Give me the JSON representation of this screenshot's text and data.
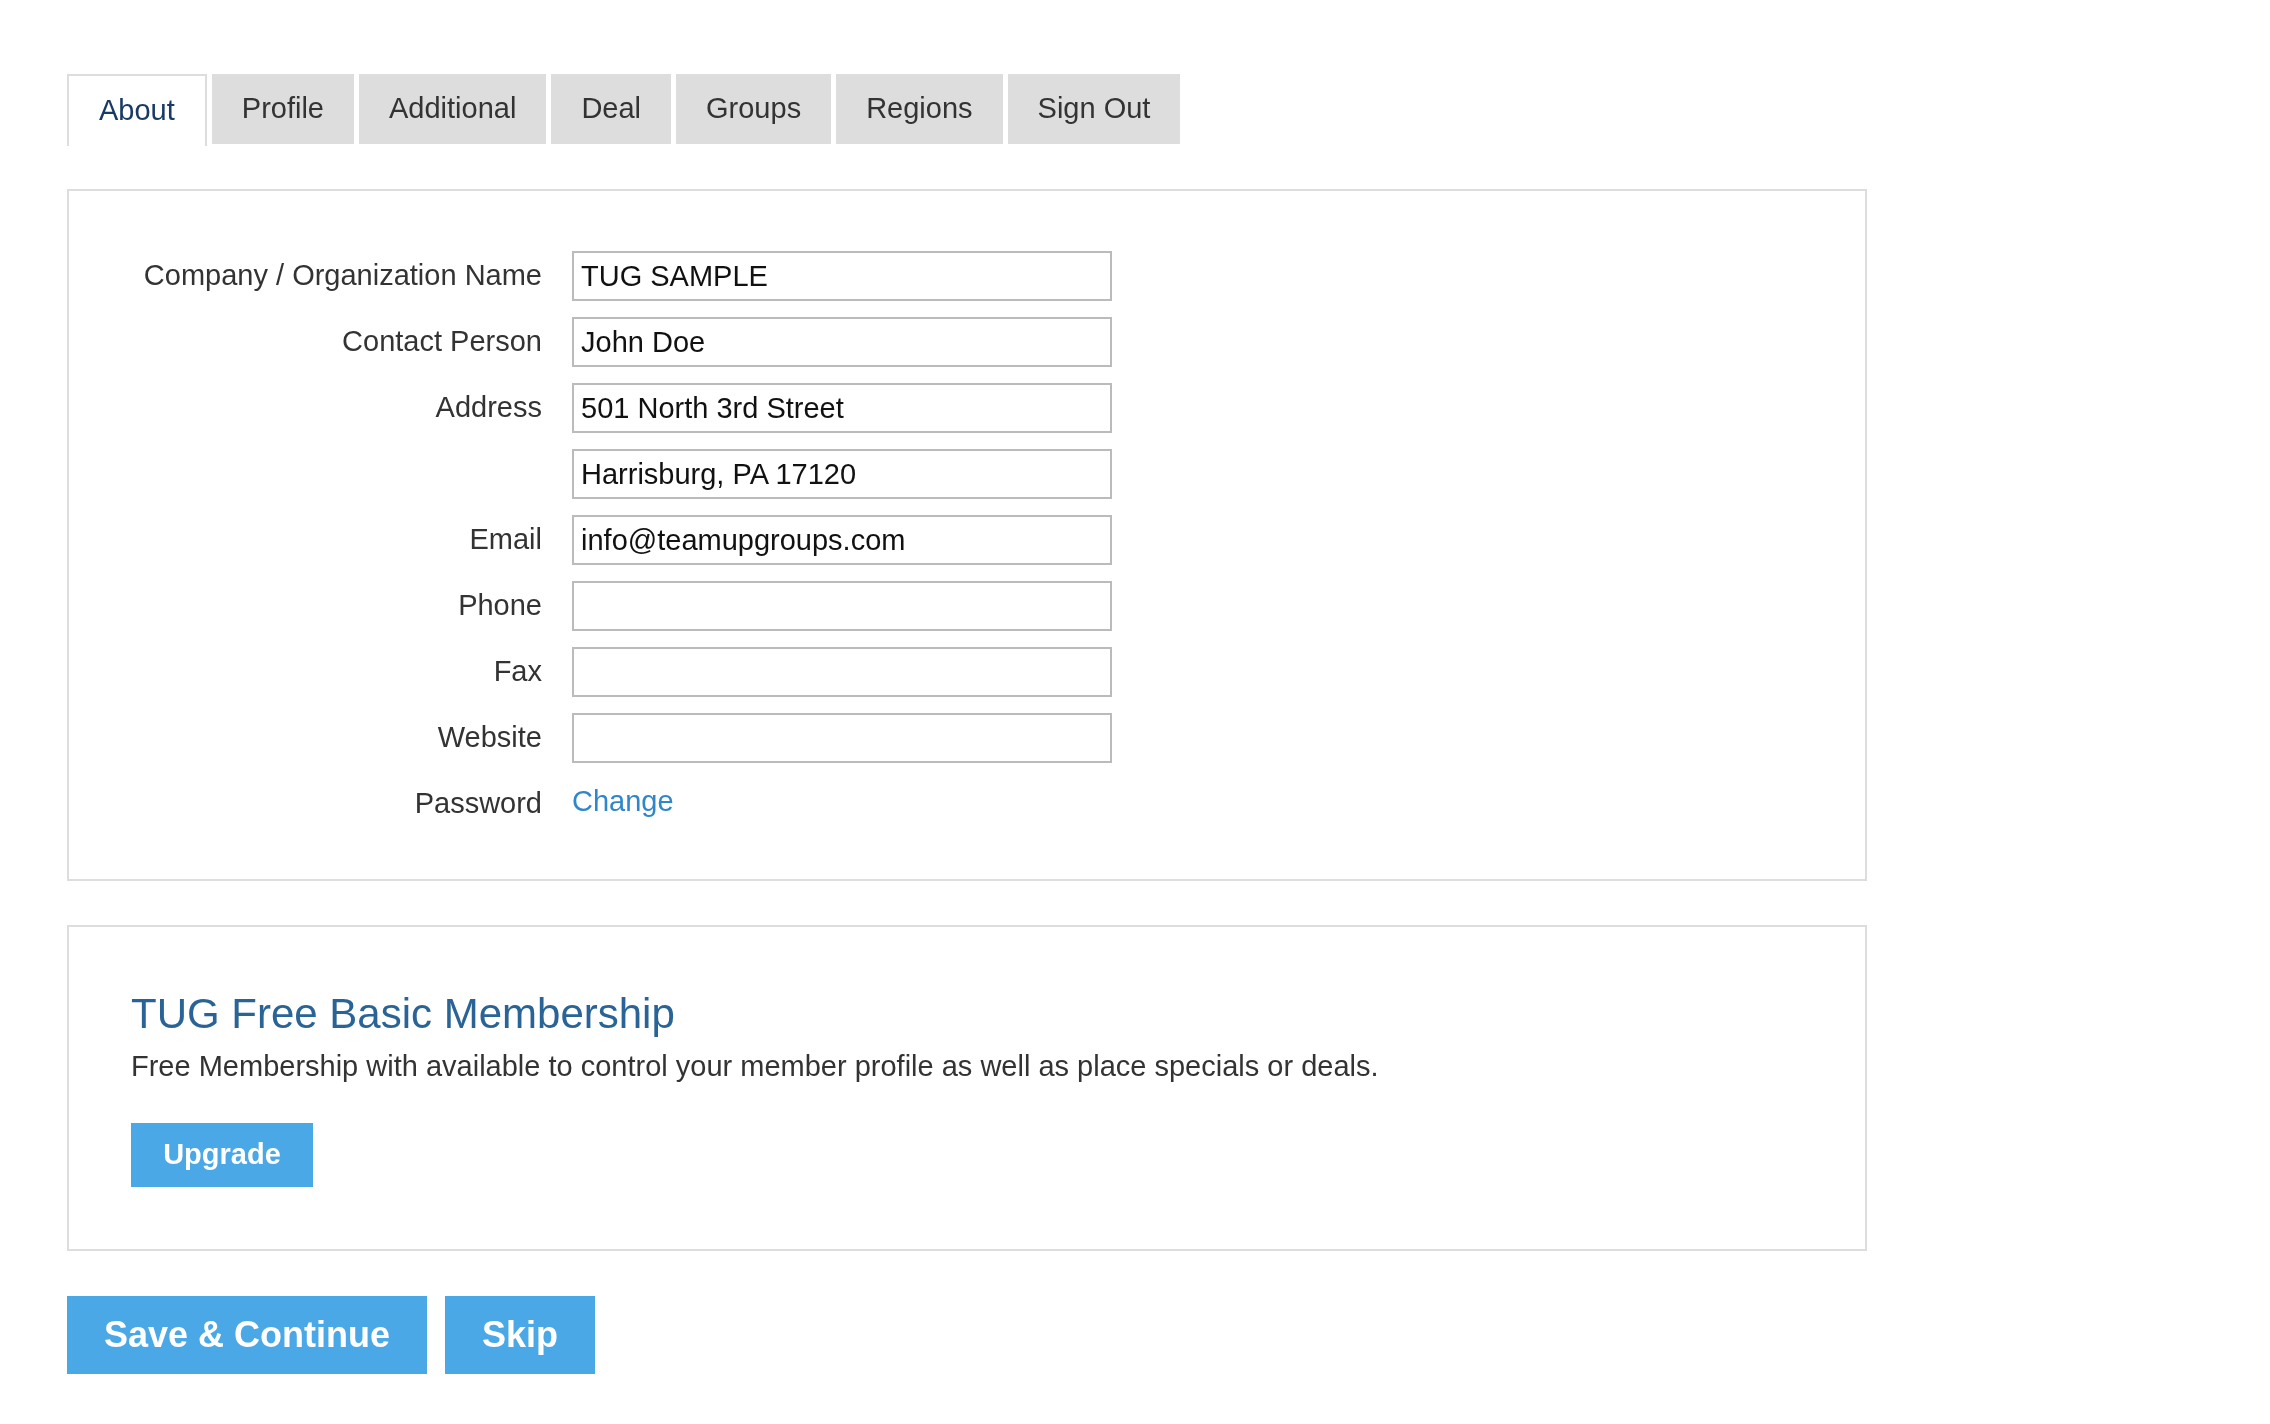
{
  "tabs": [
    {
      "label": "About",
      "selected": true
    },
    {
      "label": "Profile",
      "selected": false
    },
    {
      "label": "Additional",
      "selected": false
    },
    {
      "label": "Deal",
      "selected": false
    },
    {
      "label": "Groups",
      "selected": false
    },
    {
      "label": "Regions",
      "selected": false
    },
    {
      "label": "Sign Out",
      "selected": false
    }
  ],
  "form": {
    "fields": [
      {
        "kind": "input",
        "label": "Company / Organization Name",
        "value": "TUG SAMPLE"
      },
      {
        "kind": "input",
        "label": "Contact Person",
        "value": "John Doe"
      },
      {
        "kind": "input",
        "label": "Address",
        "value": "501 North 3rd Street"
      },
      {
        "kind": "input",
        "value": "Harrisburg, PA 17120"
      },
      {
        "kind": "input",
        "label": "Email",
        "value": "info@teamupgroups.com"
      },
      {
        "kind": "input",
        "label": "Phone"
      },
      {
        "kind": "input",
        "label": "Fax"
      },
      {
        "kind": "input",
        "label": "Website"
      },
      {
        "kind": "link",
        "label": "Password",
        "value": "Change"
      }
    ]
  },
  "membership": {
    "title": "TUG Free Basic Membership",
    "description": "Free Membership with available to control your member profile as well as place specials or deals.",
    "button": "Upgrade"
  },
  "buttons": [
    "Save & Continue",
    "Skip"
  ]
}
